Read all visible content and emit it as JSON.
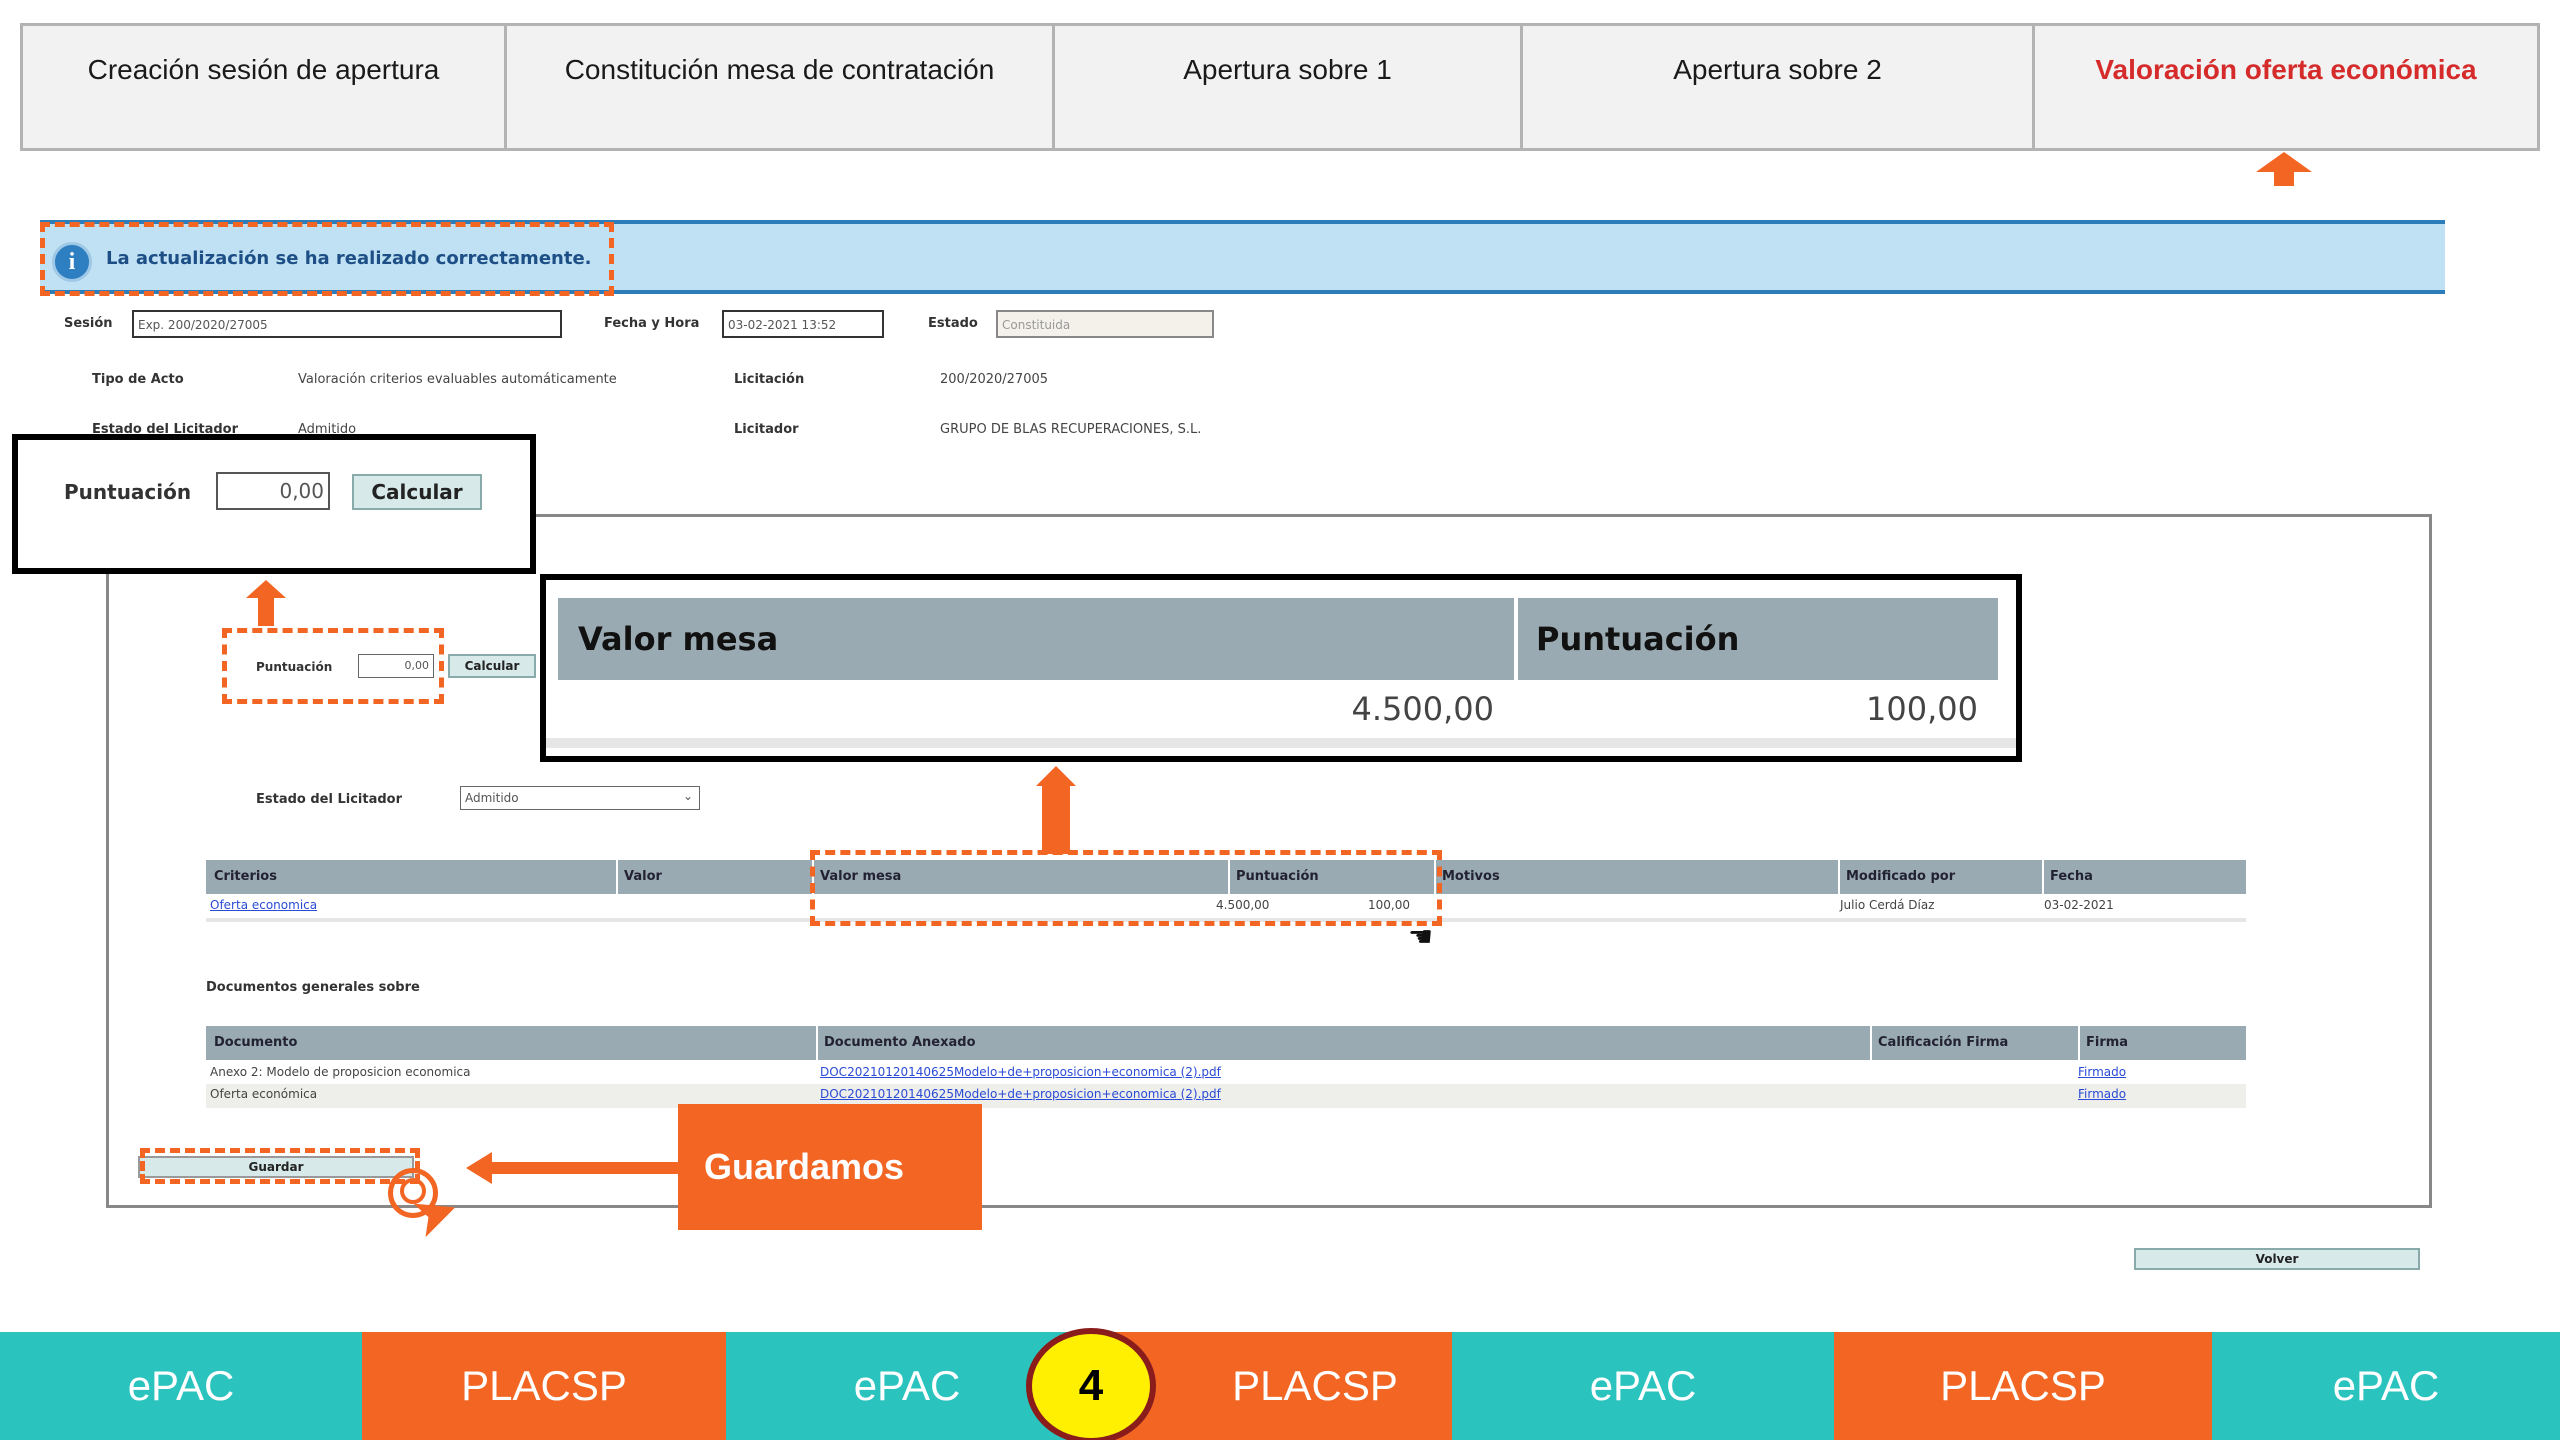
{
  "tabs": [
    {
      "label": "Creación sesión de apertura",
      "active": false
    },
    {
      "label": "Constitución mesa de contratación",
      "active": false
    },
    {
      "label": "Apertura sobre 1",
      "active": false
    },
    {
      "label": "Apertura sobre 2",
      "active": false
    },
    {
      "label": "Valoración oferta económica",
      "active": true
    }
  ],
  "info": {
    "message": "La actualización se ha realizado correctamente."
  },
  "form": {
    "sesion_label": "Sesión",
    "sesion_value": "Exp. 200/2020/27005",
    "fecha_label": "Fecha y Hora",
    "fecha_value": "03-02-2021 13:52",
    "estado_label": "Estado",
    "estado_value": "Constituida",
    "tipo_label": "Tipo de Acto",
    "tipo_value": "Valoración criterios evaluables automáticamente",
    "licitacion_label": "Licitación",
    "licitacion_value": "200/2020/27005",
    "estado_licitador_label": "Estado del Licitador",
    "estado_licitador_value": "Admitido",
    "licitador_label": "Licitador",
    "licitador_value": "GRUPO DE BLAS RECUPERACIONES, S.L."
  },
  "puntuacion": {
    "label": "Puntuación",
    "value": "0,00",
    "button": "Calcular"
  },
  "zoom_table": {
    "headers": [
      "Valor mesa",
      "Puntuación"
    ],
    "values": [
      "4.500,00",
      "100,00"
    ]
  },
  "estado_select": {
    "label": "Estado del Licitador",
    "value": "Admitido"
  },
  "criterios_table": {
    "headers": [
      "Criterios",
      "Valor",
      "Valor mesa",
      "Puntuación",
      "Motivos",
      "Modificado por",
      "Fecha"
    ],
    "row": {
      "criterio": "Oferta economica",
      "valor": "",
      "valor_mesa": "4.500,00",
      "puntuacion": "100,00",
      "motivos": "",
      "modificado_por": "Julio Cerdá Díaz",
      "fecha": "03-02-2021"
    }
  },
  "documentos": {
    "title": "Documentos generales sobre",
    "headers": [
      "Documento",
      "Documento Anexado",
      "Calificación Firma",
      "Firma"
    ],
    "rows": [
      {
        "documento": "Anexo 2: Modelo de proposicion economica",
        "anexo": "DOC20210120140625Modelo+de+proposicion+economica (2).pdf",
        "calificacion": "",
        "firma": "Firmado"
      },
      {
        "documento": "Oferta económica",
        "anexo": "DOC20210120140625Modelo+de+proposicion+economica (2).pdf",
        "calificacion": "",
        "firma": "Firmado"
      }
    ]
  },
  "buttons": {
    "guardar": "Guardar",
    "volver": "Volver"
  },
  "annotation": {
    "guardamos": "Guardamos"
  },
  "bottom_bar": [
    "ePAC",
    "PLACSP",
    "ePAC",
    "PLACSP",
    "ePAC",
    "PLACSP",
    "ePAC"
  ],
  "step_number": "4",
  "colors": {
    "accent": "#f26522",
    "teal": "#2bc3be",
    "active_tab": "#d52b2b"
  }
}
